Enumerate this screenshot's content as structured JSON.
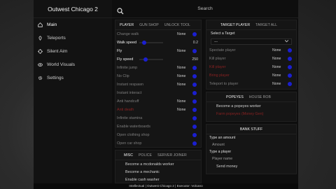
{
  "app": {
    "title": "Outwest Chicago 2"
  },
  "search": {
    "placeholder": "Search"
  },
  "sidebar": {
    "items": [
      {
        "label": "Main",
        "icon": "home-icon"
      },
      {
        "label": "Teleports",
        "icon": "location-icon"
      },
      {
        "label": "Silent Aim",
        "icon": "crosshair-icon"
      },
      {
        "label": "World Visuals",
        "icon": "eye-icon"
      },
      {
        "label": "Settings",
        "icon": "gear-icon"
      }
    ]
  },
  "player_panel": {
    "tabs": [
      "PLAYER",
      "GUN SHOP",
      "UNLOCK TOOL"
    ],
    "rows": [
      {
        "label": "Change walk",
        "value": "None"
      },
      {
        "label": "Walk speed",
        "value": "0.2"
      },
      {
        "label": "Fly",
        "value": "None"
      },
      {
        "label": "Fly speed",
        "value": "250"
      },
      {
        "label": "Infinite jump",
        "value": "None"
      },
      {
        "label": "No Clip",
        "value": "None"
      },
      {
        "label": "Instant respawn",
        "value": "None"
      },
      {
        "label": "Instant interact",
        "value": ""
      },
      {
        "label": "Anti handcuff",
        "value": "None"
      },
      {
        "label": "Anti death",
        "value": "None"
      },
      {
        "label": "Infinite stamina",
        "value": ""
      },
      {
        "label": "Enable waterboards",
        "value": ""
      },
      {
        "label": "Open clothing shop",
        "value": ""
      },
      {
        "label": "Open car shop",
        "value": ""
      }
    ]
  },
  "misc_panel": {
    "tabs": [
      "MISC",
      "POLICE",
      "SERVER JOINER"
    ],
    "items": [
      "Become a mcdonalds worker",
      "Become a mechanic",
      "Enable cash washer"
    ]
  },
  "target_panel": {
    "tabs": [
      "TARGET PLAYER",
      "TARGET ALL"
    ],
    "select_label": "Select a Target",
    "select_value": "---",
    "rows": [
      {
        "label": "Spectate player",
        "value": "None"
      },
      {
        "label": "Kill player",
        "value": "None"
      },
      {
        "label": "Kill player",
        "value": "None"
      },
      {
        "label": "Bring player",
        "value": "None"
      },
      {
        "label": "Teleport to player",
        "value": "None"
      }
    ]
  },
  "popeyes_panel": {
    "tabs": [
      "POPEYES",
      "HOUSE ROB"
    ],
    "items": [
      "Become a popeyes worker",
      "Farm popeyes (Money Gen)"
    ]
  },
  "bank_panel": {
    "title": "BANK STUFF",
    "amount_label": "Type an amount",
    "amount_placeholder": "Amount",
    "player_label": "Type a player",
    "player_placeholder": "Player name",
    "send_label": "Send money"
  },
  "statusbar": {
    "text": "Intellectual | Outwest Chicago 2 | Executor: Volcano"
  },
  "colors": {
    "accent": "#1b1fd0",
    "danger": "#8a2222"
  }
}
